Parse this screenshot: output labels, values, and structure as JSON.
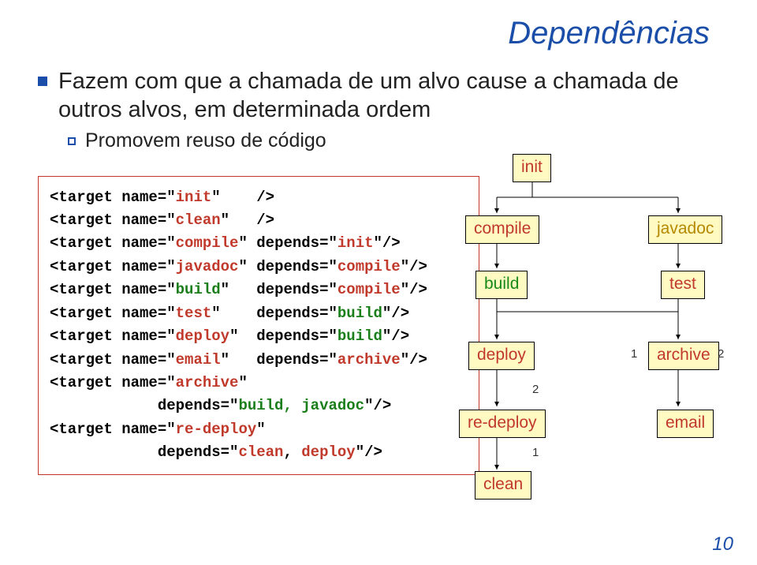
{
  "title": "Dependências",
  "bullets": {
    "l1": "Fazem com que a chamada de um alvo cause a chamada de outros alvos, em determinada ordem",
    "l2": "Promovem reuso de código"
  },
  "code": {
    "lines": [
      {
        "raw": "<target name=\"",
        "name": "init",
        "rest": "\"    />"
      },
      {
        "raw": "<target name=\"",
        "name": "clean",
        "rest": "\"   />"
      },
      {
        "raw": "<target name=\"",
        "name": "compile",
        "rest": "\" depends=\"",
        "dep": "init",
        "end": "\"/>"
      },
      {
        "raw": "<target name=\"",
        "name": "javadoc",
        "rest": "\" depends=\"",
        "dep": "compile",
        "end": "\"/>"
      },
      {
        "raw": "<target name=\"",
        "name": "build",
        "rest": "\"   depends=\"",
        "dep": "compile",
        "end": "\"/>"
      },
      {
        "raw": "<target name=\"",
        "name": "test",
        "rest": "\"    depends=\"",
        "dep": "build",
        "end": "\"/>"
      },
      {
        "raw": "<target name=\"",
        "name": "deploy",
        "rest": "\"  depends=\"",
        "dep": "build",
        "end": "\"/>"
      },
      {
        "raw": "<target name=\"",
        "name": "email",
        "rest": "\"   depends=\"",
        "dep": "archive",
        "end": "\"/>"
      },
      {
        "raw": "<target name=\"",
        "name": "archive",
        "rest": "\"",
        "dep": "",
        "end": ""
      },
      {
        "raw": "            depends=\"",
        "dep": "build, javadoc",
        "end": "\"/>"
      },
      {
        "raw": "<target name=\"",
        "name": "re-deploy",
        "rest": "\"",
        "dep": "",
        "end": ""
      },
      {
        "raw": "            depends=\"",
        "dep2": "clean",
        "mid": ", ",
        "dep3": "deploy",
        "end": "\"/>"
      }
    ]
  },
  "diagram": {
    "init": "init",
    "compile": "compile",
    "javadoc": "javadoc",
    "build": "build",
    "test": "test",
    "deploy": "deploy",
    "archive": "archive",
    "redeploy": "re-deploy",
    "email": "email",
    "clean": "clean",
    "n1a": "1",
    "n2a": "2",
    "n1b": "1",
    "n2b": "2"
  },
  "page": "10"
}
